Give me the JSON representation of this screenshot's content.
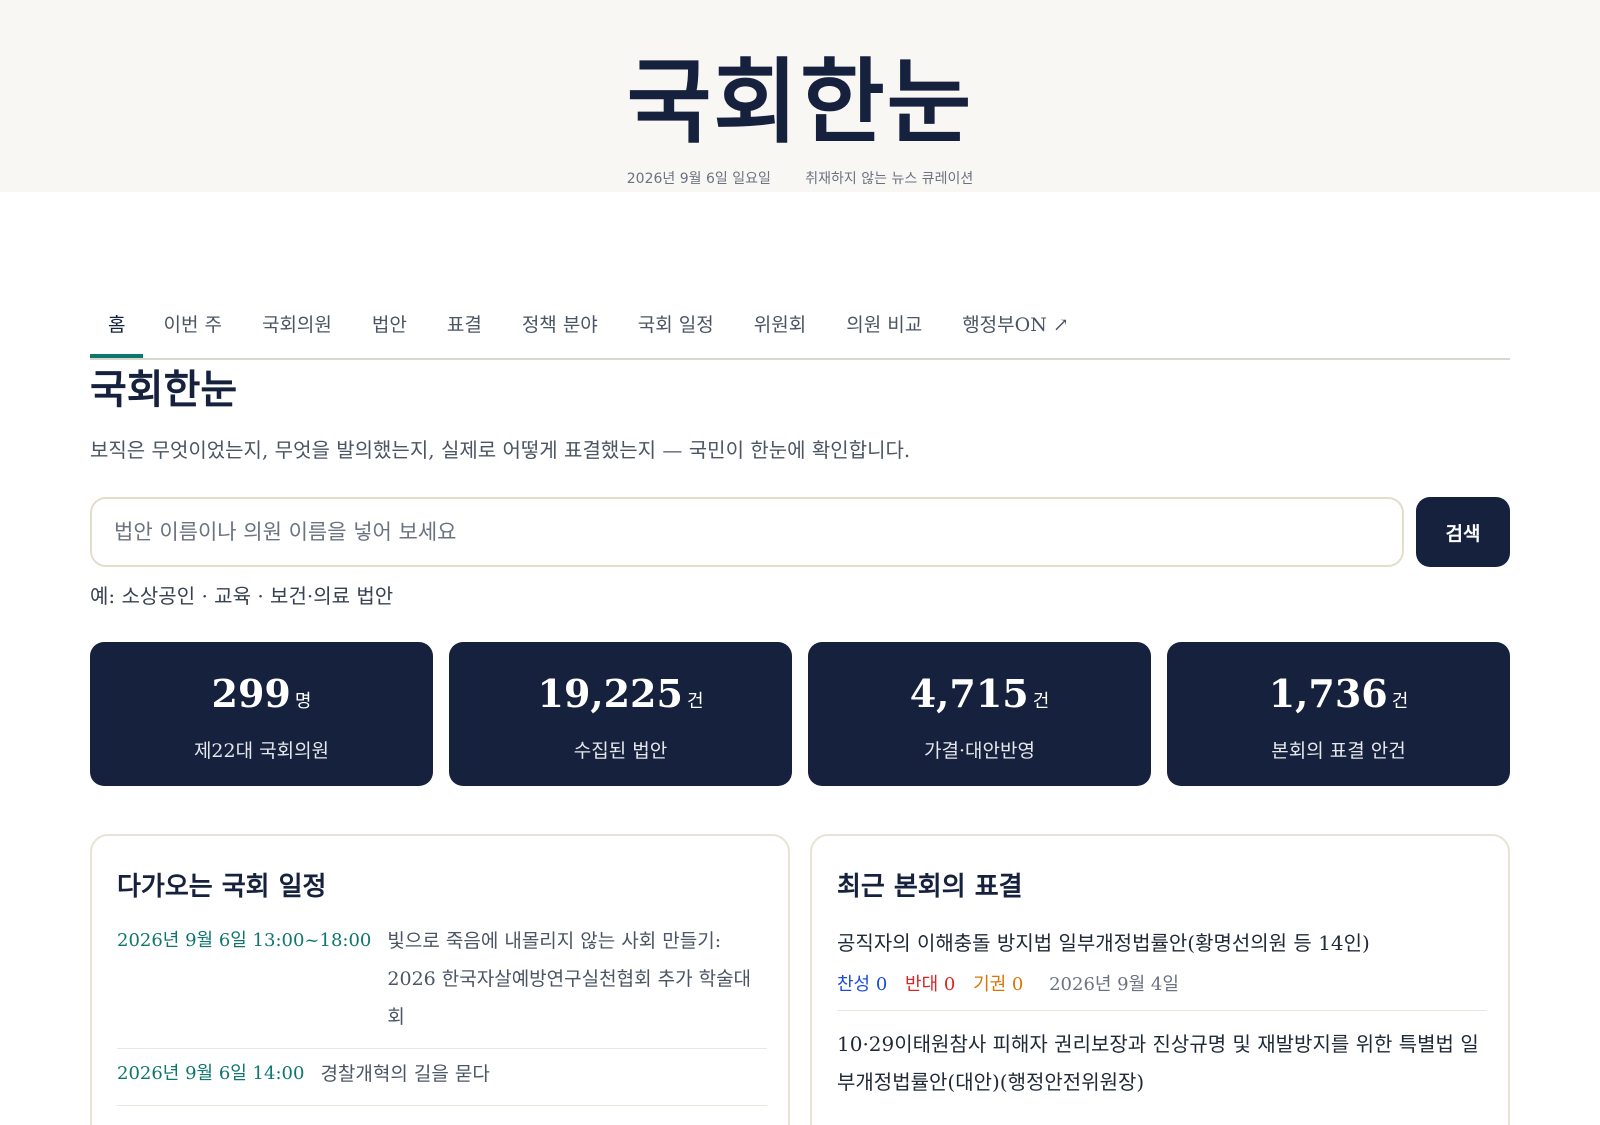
{
  "masthead": {
    "title": "국회한눈",
    "date": "2026년 9월 6일 일요일",
    "tagline": "취재하지 않는 뉴스 큐레이션"
  },
  "nav": {
    "items": [
      "홈",
      "이번 주",
      "국회의원",
      "법안",
      "표결",
      "정책 분야",
      "국회 일정",
      "위원회",
      "의원 비교",
      "행정부ON ↗"
    ],
    "active": "홈"
  },
  "hero": {
    "title": "국회한눈",
    "description": "보직은 무엇이었는지, 무엇을 발의했는지, 실제로 어떻게 표결했는지 — 국민이 한눈에 확인합니다."
  },
  "search": {
    "placeholder": "법안 이름이나 의원 이름을 넣어 보세요",
    "button": "검색",
    "examples": "예: 소상공인 · 교육 · 보건·의료 법안"
  },
  "stats": [
    {
      "value": "299",
      "unit": "명",
      "label": "제22대 국회의원"
    },
    {
      "value": "19,225",
      "unit": "건",
      "label": "수집된 법안"
    },
    {
      "value": "4,715",
      "unit": "건",
      "label": "가결·대안반영"
    },
    {
      "value": "1,736",
      "unit": "건",
      "label": "본회의 표결 안건"
    }
  ],
  "schedule": {
    "title": "다가오는 국회 일정",
    "items": [
      {
        "date": "2026년 9월 6일 13:00~18:00",
        "text": "빛으로 죽음에 내몰리지 않는 사회 만들기: 2026 한국자살예방연구실천협회 추가 학술대회"
      },
      {
        "date": "2026년 9월 6일 14:00",
        "text": "경찰개혁의 길을 묻다"
      }
    ]
  },
  "votes": {
    "title": "최근 본회의 표결",
    "items": [
      {
        "title": "공직자의 이해충돌 방지법 일부개정법률안(황명선의원 등 14인)",
        "yes": "찬성 0",
        "no": "반대 0",
        "abstain": "기권 0",
        "date": "2026년 9월 4일"
      },
      {
        "title": "10·29이태원참사 피해자 권리보장과 진상규명 및 재발방지를 위한 특별법 일부개정법률안(대안)(행정안전위원장)"
      }
    ]
  },
  "colors": {
    "navy": "#16213e",
    "teal": "#0f766e",
    "masthead_bg": "#f8f7f4"
  }
}
